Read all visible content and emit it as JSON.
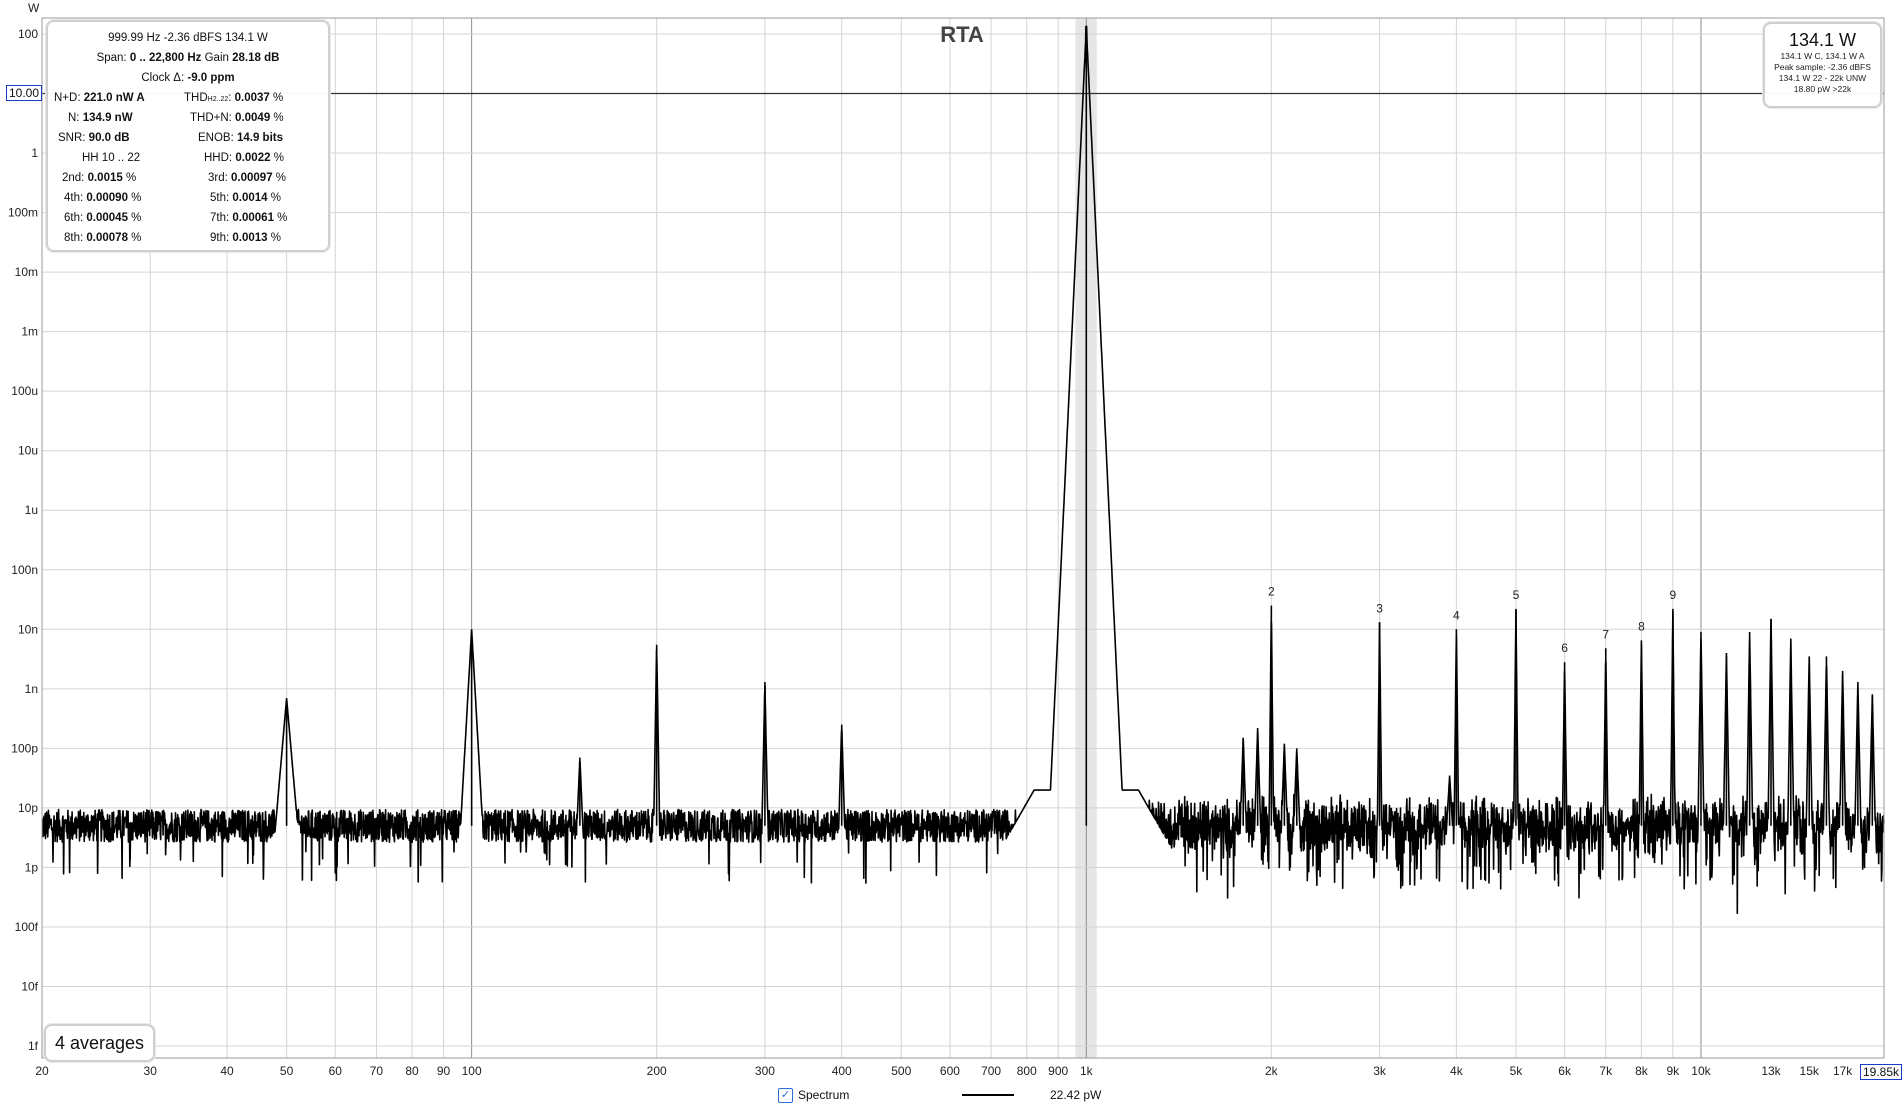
{
  "chart_data": {
    "type": "line",
    "title": "RTA",
    "ylabel": "W",
    "xscale": "log",
    "yscale": "log",
    "xlim": [
      20,
      19850
    ],
    "ylim": [
      1e-15,
      100
    ],
    "x_ticks": [
      {
        "v": 20,
        "label": "20"
      },
      {
        "v": 30,
        "label": "30"
      },
      {
        "v": 40,
        "label": "40"
      },
      {
        "v": 50,
        "label": "50"
      },
      {
        "v": 60,
        "label": "60"
      },
      {
        "v": 70,
        "label": "70"
      },
      {
        "v": 80,
        "label": "80"
      },
      {
        "v": 90,
        "label": "90"
      },
      {
        "v": 100,
        "label": "100"
      },
      {
        "v": 200,
        "label": "200"
      },
      {
        "v": 300,
        "label": "300"
      },
      {
        "v": 400,
        "label": "400"
      },
      {
        "v": 500,
        "label": "500"
      },
      {
        "v": 600,
        "label": "600"
      },
      {
        "v": 700,
        "label": "700"
      },
      {
        "v": 800,
        "label": "800"
      },
      {
        "v": 900,
        "label": "900"
      },
      {
        "v": 1000,
        "label": "1k"
      },
      {
        "v": 2000,
        "label": "2k"
      },
      {
        "v": 3000,
        "label": "3k"
      },
      {
        "v": 4000,
        "label": "4k"
      },
      {
        "v": 5000,
        "label": "5k"
      },
      {
        "v": 6000,
        "label": "6k"
      },
      {
        "v": 7000,
        "label": "7k"
      },
      {
        "v": 8000,
        "label": "8k"
      },
      {
        "v": 9000,
        "label": "9k"
      },
      {
        "v": 10000,
        "label": "10k"
      },
      {
        "v": 13000,
        "label": "13k"
      },
      {
        "v": 15000,
        "label": "15k"
      },
      {
        "v": 17000,
        "label": "17k"
      }
    ],
    "y_ticks": [
      {
        "v": 100,
        "label": "100"
      },
      {
        "v": 1,
        "label": "1"
      },
      {
        "v": 0.1,
        "label": "100m"
      },
      {
        "v": 0.01,
        "label": "10m"
      },
      {
        "v": 0.001,
        "label": "1m"
      },
      {
        "v": 0.0001,
        "label": "100u"
      },
      {
        "v": 1e-05,
        "label": "10u"
      },
      {
        "v": 1e-06,
        "label": "1u"
      },
      {
        "v": 1e-07,
        "label": "100n"
      },
      {
        "v": 1e-08,
        "label": "10n"
      },
      {
        "v": 1e-09,
        "label": "1n"
      },
      {
        "v": 1e-10,
        "label": "100p"
      },
      {
        "v": 1e-11,
        "label": "10p"
      },
      {
        "v": 1e-12,
        "label": "1p"
      },
      {
        "v": 1e-13,
        "label": "100f"
      },
      {
        "v": 1e-14,
        "label": "10f"
      },
      {
        "v": 1e-15,
        "label": "1f"
      }
    ],
    "cursor": {
      "y": 10,
      "y_label": "10.00",
      "x": 19850,
      "x_label": "19.85k"
    },
    "fundamental": {
      "freq": 999.99,
      "power": 134.1
    },
    "highlight_band": [
      960,
      1040
    ],
    "noise_floor": 5e-12,
    "harmonics": [
      {
        "n": "2",
        "freq": 2000,
        "power": 2.5e-08
      },
      {
        "n": "3",
        "freq": 3000,
        "power": 1.3e-08
      },
      {
        "n": "4",
        "freq": 4000,
        "power": 1e-08
      },
      {
        "n": "5",
        "freq": 5000,
        "power": 2.2e-08
      },
      {
        "n": "6",
        "freq": 6000,
        "power": 2.8e-09
      },
      {
        "n": "7",
        "freq": 7000,
        "power": 4.8e-09
      },
      {
        "n": "8",
        "freq": 8000,
        "power": 6.5e-09
      },
      {
        "n": "9",
        "freq": 9000,
        "power": 2.2e-08
      }
    ],
    "spurs": [
      {
        "freq": 50,
        "power": 7e-10
      },
      {
        "freq": 100,
        "power": 1e-08
      },
      {
        "freq": 150,
        "power": 7e-11
      },
      {
        "freq": 200,
        "power": 5.5e-09
      },
      {
        "freq": 300,
        "power": 1.3e-09
      },
      {
        "freq": 400,
        "power": 2.5e-10
      },
      {
        "freq": 1800,
        "power": 1.5e-10
      },
      {
        "freq": 1900,
        "power": 2.2e-10
      },
      {
        "freq": 2100,
        "power": 1.2e-10
      },
      {
        "freq": 2200,
        "power": 1e-10
      },
      {
        "freq": 3900,
        "power": 3.5e-11
      },
      {
        "freq": 10000,
        "power": 9e-09
      },
      {
        "freq": 11000,
        "power": 4e-09
      },
      {
        "freq": 12000,
        "power": 9e-09
      },
      {
        "freq": 13000,
        "power": 1.5e-08
      },
      {
        "freq": 14000,
        "power": 7e-09
      },
      {
        "freq": 15000,
        "power": 3.5e-09
      },
      {
        "freq": 16000,
        "power": 3.5e-09
      },
      {
        "freq": 17000,
        "power": 2e-09
      },
      {
        "freq": 18000,
        "power": 1.3e-09
      },
      {
        "freq": 19000,
        "power": 8e-10
      }
    ],
    "series": [
      {
        "name": "Spectrum",
        "color": "#000000",
        "legend_value": "22.42 pW"
      }
    ]
  },
  "stats": {
    "line1": "999.99 Hz  -2.36 dBFS  134.1 W",
    "span_label": "Span: ",
    "span_value": "0 .. 22,800 Hz",
    "gain_label": "  Gain ",
    "gain_value": "28.18 dB",
    "clock_label": "Clock Δ: ",
    "clock_value": "-9.0 ppm",
    "nd_label": "N+D: ",
    "nd_value": "221.0 nW A",
    "thd_label": "THD",
    "thd_sub": "H2..22",
    "thd_value": "0.0037",
    "n_label": "N: ",
    "n_value": "134.9 nW",
    "thdn_label": "THD+N: ",
    "thdn_value": "0.0049",
    "snr_label": "SNR: ",
    "snr_value": "90.0 dB",
    "enob_label": "ENOB: ",
    "enob_value": "14.9 bits",
    "hh_label": "HH 10 .. 22",
    "hhd_label": "HHD: ",
    "hhd_value": "0.0022",
    "h2_label": "2nd: ",
    "h2_value": "0.0015",
    "h3_label": "3rd: ",
    "h3_value": "0.00097",
    "h4_label": "4th: ",
    "h4_value": "0.00090",
    "h5_label": "5th: ",
    "h5_value": "0.0014",
    "h6_label": "6th: ",
    "h6_value": "0.00045",
    "h7_label": "7th: ",
    "h7_value": "0.00061",
    "h8_label": "8th: ",
    "h8_value": "0.00078",
    "h9_label": "9th: ",
    "h9_value": "0.0013",
    "pct": " %"
  },
  "level": {
    "big": "134.1 W",
    "l1": "134.1 W C, 134.1 W A",
    "l2": "Peak sample: -2.36 dBFS",
    "l3": "134.1 W 22 - 22k UNW",
    "l4": "18.80 pW >22k"
  },
  "averages": "4 averages",
  "legend": {
    "checked": "✓"
  }
}
